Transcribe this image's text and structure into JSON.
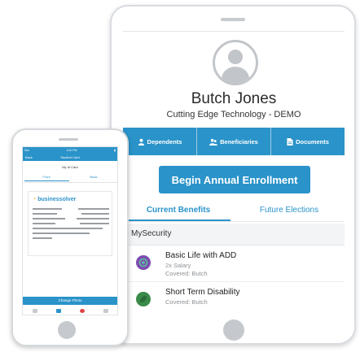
{
  "tablet": {
    "profile": {
      "name": "Butch Jones",
      "company": "Cutting Edge Technology - DEMO"
    },
    "tabs": [
      {
        "label": "Dependents",
        "icon": "person-icon"
      },
      {
        "label": "Beneficiaries",
        "icon": "people-icon"
      },
      {
        "label": "Documents",
        "icon": "document-icon"
      }
    ],
    "enroll_button": "Begin Annual Enrollment",
    "subtabs": {
      "current": "Current Benefits",
      "future": "Future Elections"
    },
    "section_title": "MySecurity",
    "benefits": [
      {
        "title": "Basic Life with ADD",
        "detail": "2x Salary",
        "covered": "Covered: Butch",
        "icon": "shield-icon",
        "color": "#7d4cb0"
      },
      {
        "title": "Short Term Disability",
        "detail": "Covered: Butch",
        "icon": "leaf-icon",
        "color": "#3a8a4a"
      }
    ]
  },
  "phone": {
    "status": {
      "carrier": "Sim",
      "time": "4:20 PM"
    },
    "nav": {
      "back": "Back",
      "title": "Student Card"
    },
    "card_title": "My Id Card",
    "tabs": {
      "front": "Front",
      "back": "Back"
    },
    "logo": "businessolver",
    "change_photo": "Change Photo"
  },
  "colors": {
    "accent": "#2a93c9",
    "logo_mark": "#f0a323"
  }
}
